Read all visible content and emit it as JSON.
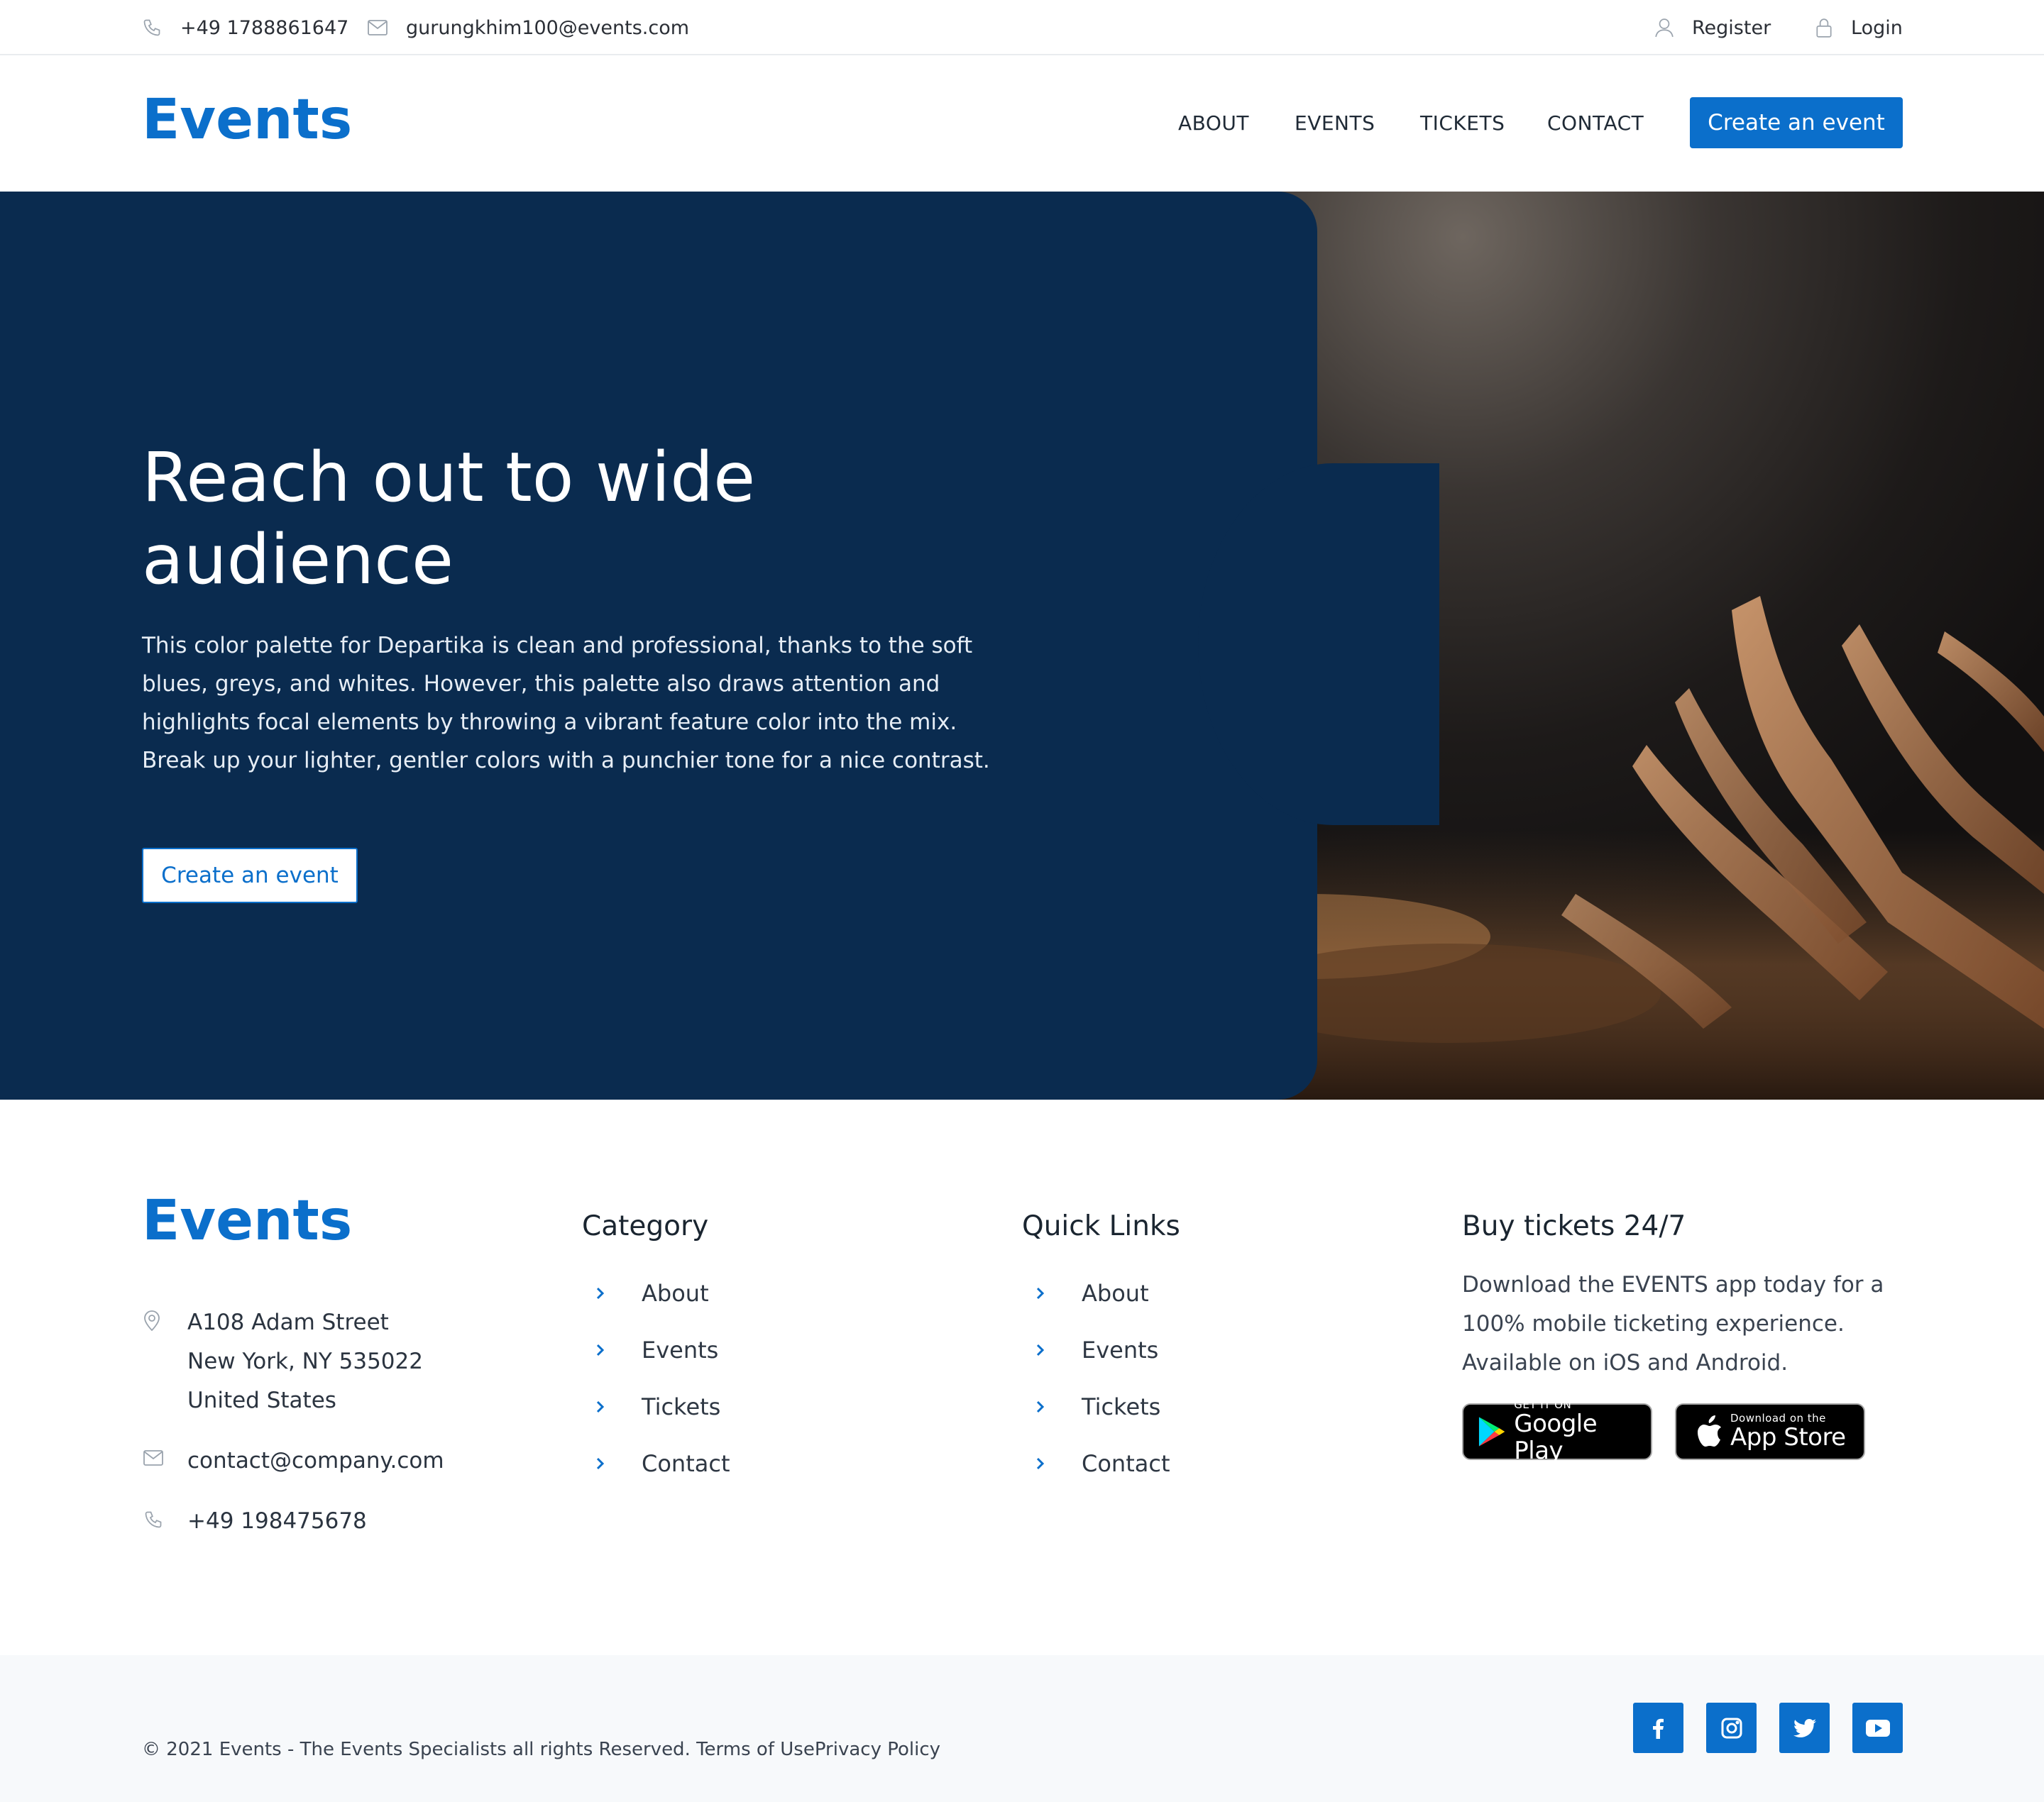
{
  "topbar": {
    "phone": "+49 1788861647",
    "email": "gurungkhim100@events.com",
    "register": "Register",
    "login": "Login"
  },
  "nav": {
    "logo": "Events",
    "links": [
      "ABOUT",
      "EVENTS",
      "TICKETS",
      "CONTACT"
    ],
    "cta": "Create an event"
  },
  "hero": {
    "title_line1": "Reach out to wide",
    "title_line2": "audience",
    "text": "This color palette for Departika is clean and professional, thanks to the soft blues, greys, and whites. However, this palette also draws attention and highlights focal elements by throwing a vibrant feature color into the mix. Break up your lighter, gentler colors with a punchier tone for a nice contrast.",
    "cta": "Create an event"
  },
  "footer": {
    "logo": "Events",
    "address": [
      "A108 Adam Street",
      "New York, NY 535022",
      "United States"
    ],
    "email": "contact@company.com",
    "phone": "+49 198475678",
    "category": {
      "title": "Category",
      "links": [
        "About",
        "Events",
        "Tickets",
        "Contact"
      ]
    },
    "quick_links": {
      "title": "Quick Links",
      "links": [
        "About",
        "Events",
        "Tickets",
        "Contact"
      ]
    },
    "buy": {
      "title": "Buy tickets 24/7",
      "text": "Download the EVENTS app today for a 100% mobile ticketing experience. Available on iOS and Android.",
      "google_small": "GET IT ON",
      "google_big": "Google Play",
      "apple_small": "Download on the",
      "apple_big": "App Store"
    }
  },
  "bottom": {
    "copyright": "© 2021 Events - The Events Specialists all rights Reserved. Terms of UsePrivacy Policy",
    "social": [
      "facebook-icon",
      "instagram-icon",
      "twitter-icon",
      "youtube-icon"
    ]
  },
  "colors": {
    "brand": "#0b6fcb",
    "hero_panel": "#0a2b4f",
    "bottom_bg": "#f7f9fb"
  }
}
